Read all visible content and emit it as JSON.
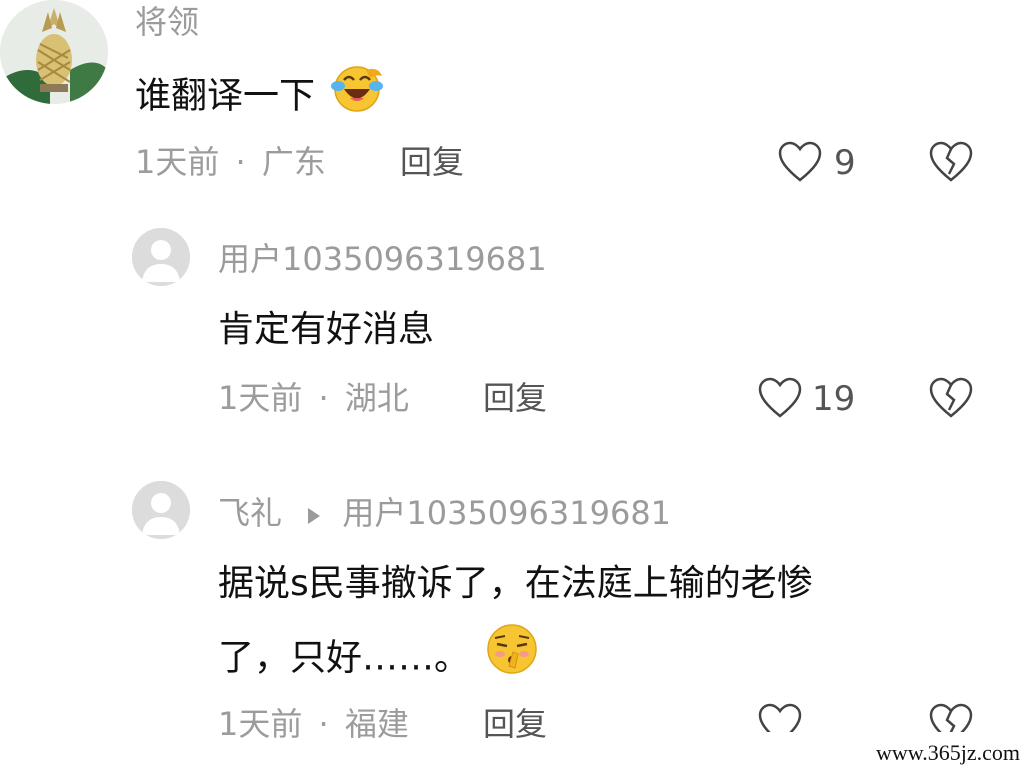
{
  "comments": [
    {
      "username": "将领",
      "text": "谁翻译一下",
      "time": "1天前",
      "sep": "·",
      "location": "广东",
      "reply_label": "回复",
      "likes": "9",
      "emoji": "face-with-tears-of-joy"
    },
    {
      "username": "用户1035096319681",
      "text": "肯定有好消息",
      "time": "1天前",
      "sep": "·",
      "location": "湖北",
      "reply_label": "回复",
      "likes": "19"
    },
    {
      "username": "飞礼",
      "reply_to": "用户1035096319681",
      "text_line1": "据说s民事撤诉了，在法庭上输的老惨",
      "text_line2": "了，只好……。",
      "time": "1天前",
      "sep": "·",
      "location": "福建",
      "reply_label": "回复",
      "emoji": "shushing-tired-face"
    }
  ],
  "watermark": "www.365jz.com",
  "icons": [
    "heart-outline-icon",
    "broken-heart-icon",
    "reply-arrow-icon",
    "default-avatar-icon"
  ]
}
